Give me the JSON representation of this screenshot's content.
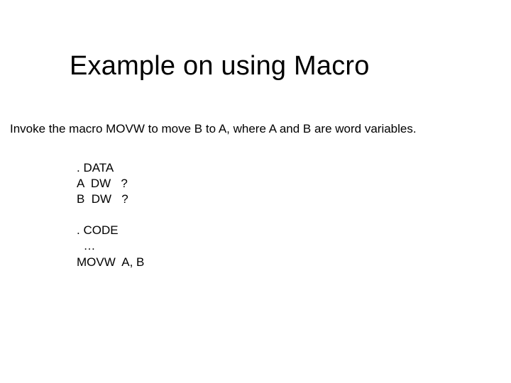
{
  "title": "Example on using Macro",
  "subtext": "Invoke the macro MOVW to move B to A, where A and B are word variables.",
  "code": {
    "l1": ". DATA",
    "l2": "A  DW   ?",
    "l3": "B  DW   ?",
    "l4": "",
    "l5": ". CODE",
    "l6": "  …",
    "l7": "MOVW  A, B"
  }
}
